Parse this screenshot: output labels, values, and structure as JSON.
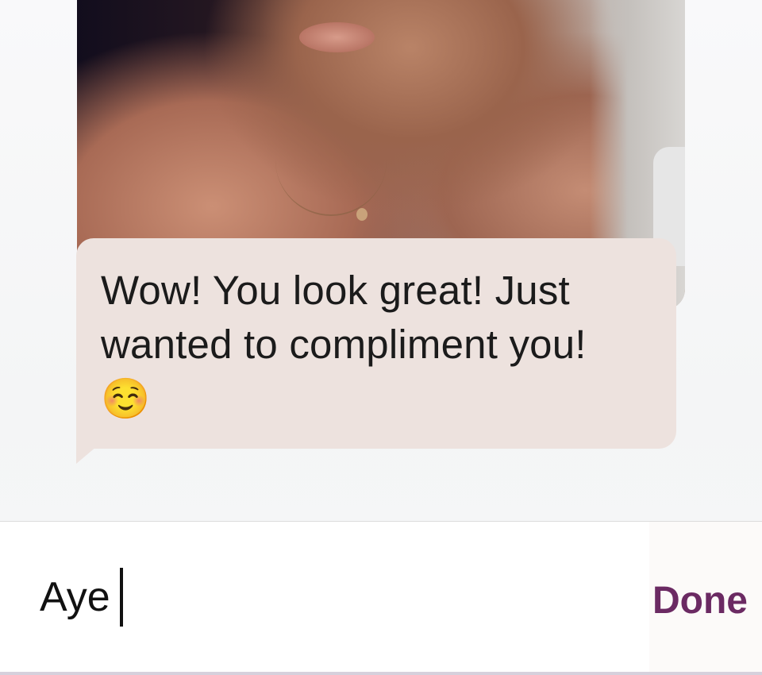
{
  "conversation": {
    "photo": {
      "description_icon": "received-photo"
    },
    "message": {
      "text": "Wow! You look great! Just wanted to compliment you!",
      "emoji": "☺️",
      "bubble_color": "#ede2de"
    }
  },
  "composer": {
    "input_value": "Aye",
    "done_label": "Done",
    "accent_color": "#6b2a63"
  }
}
